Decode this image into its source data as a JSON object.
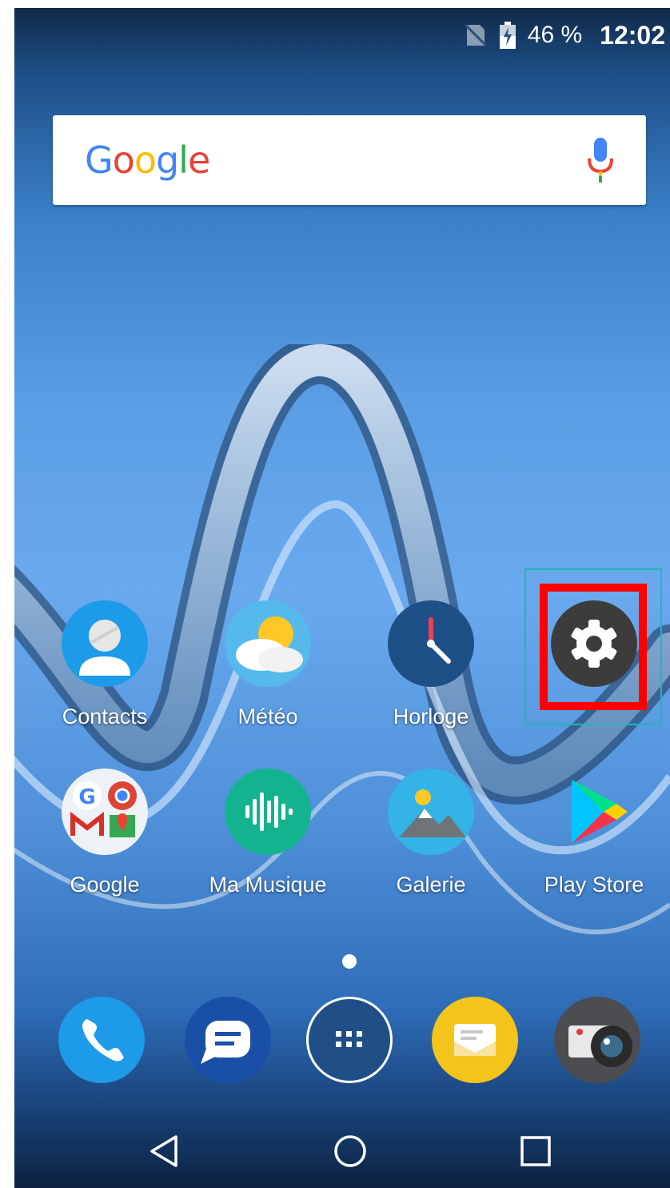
{
  "statusbar": {
    "battery": "46 %",
    "time": "12:02"
  },
  "search": {
    "logo": "Google"
  },
  "home_apps": [
    {
      "label": "Contacts"
    },
    {
      "label": "Météo"
    },
    {
      "label": "Horloge"
    },
    {
      "label": "Google"
    },
    {
      "label": "Ma Musique"
    },
    {
      "label": "Galerie"
    },
    {
      "label": "Play Store"
    }
  ],
  "highlighted_app": {
    "icon": "gear-icon"
  },
  "dock": [
    "phone-icon",
    "messages-icon",
    "app-drawer-icon",
    "email-icon",
    "camera-icon"
  ],
  "navigation": [
    "back-icon",
    "home-icon",
    "recents-icon"
  ],
  "colors": {
    "highlight_border": "#ff0000",
    "highlight_outline": "#22b5b5"
  }
}
